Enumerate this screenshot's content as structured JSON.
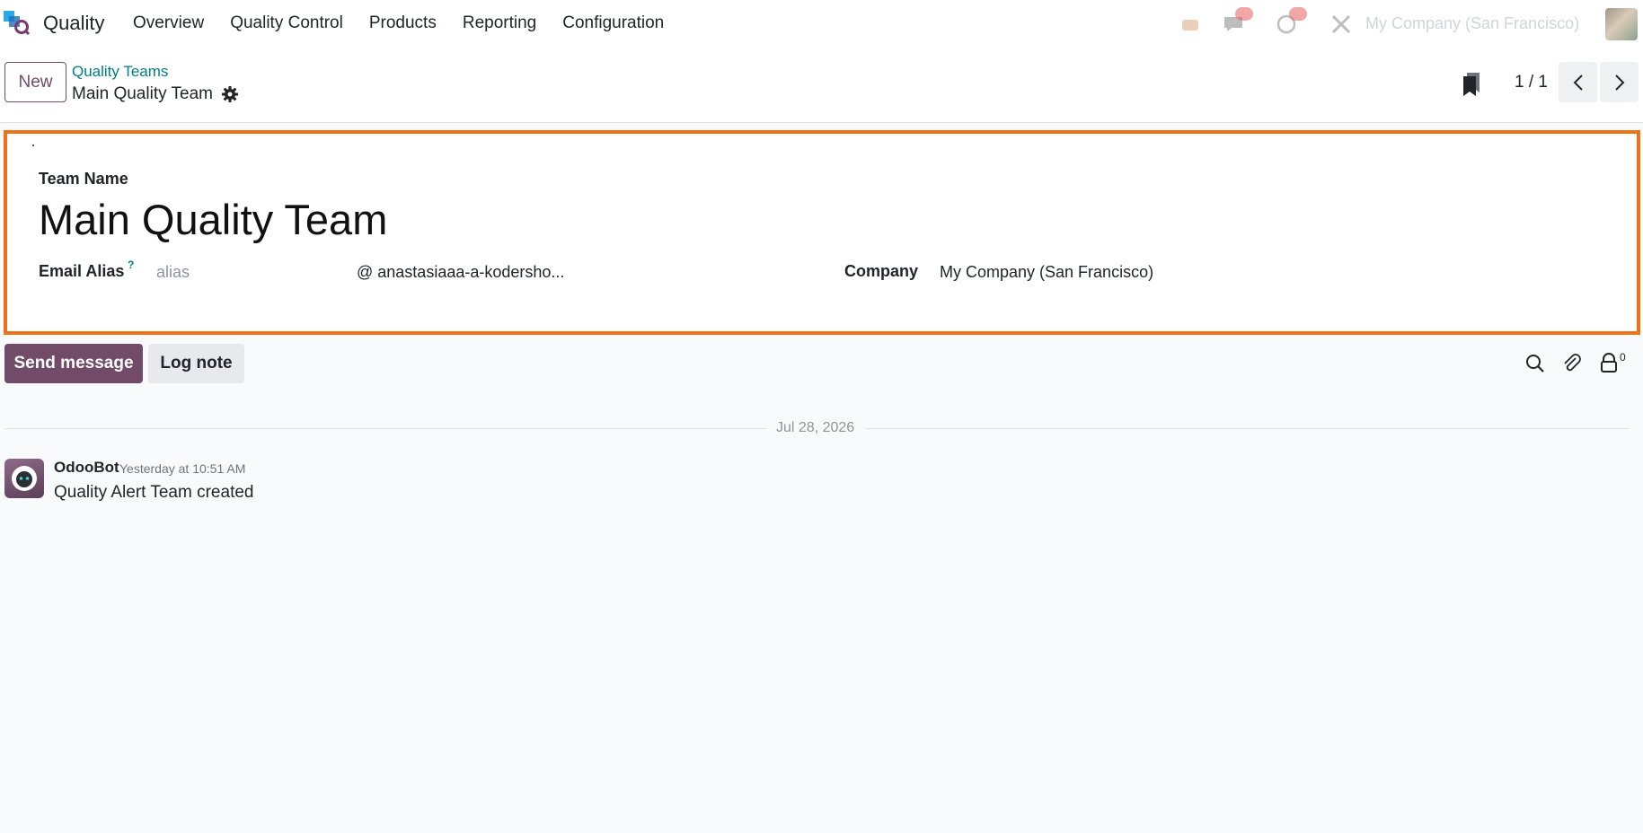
{
  "navbar": {
    "app_name": "Quality",
    "menu": [
      "Overview",
      "Quality Control",
      "Products",
      "Reporting",
      "Configuration"
    ],
    "company": "My Company (San Francisco)"
  },
  "control_panel": {
    "new_label": "New",
    "breadcrumb_parent": "Quality Teams",
    "breadcrumb_current": "Main Quality Team",
    "pager": "1 / 1"
  },
  "form": {
    "team_name_label": "Team Name",
    "team_name": "Main Quality Team",
    "email_alias_label": "Email Alias",
    "help_marker": "?",
    "alias_placeholder": "alias",
    "alias_domain": "@ anastasiaaa-a-kodersho...",
    "company_label": "Company",
    "company_value": "My Company (San Francisco)"
  },
  "chatter": {
    "send_message_label": "Send message",
    "log_note_label": "Log note",
    "followers_count": "0",
    "date_separator": "Jul 28, 2026",
    "messages": [
      {
        "author": "OdooBot",
        "time": "Yesterday at 10:51 AM",
        "body": "Quality Alert Team created"
      }
    ]
  },
  "colors": {
    "brand": "#714b67",
    "link": "#017e84",
    "highlight_border": "#f07216"
  }
}
